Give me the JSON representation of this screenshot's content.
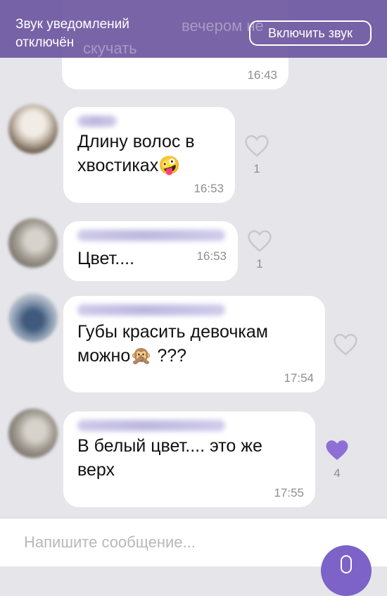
{
  "banner": {
    "text": "Звук уведомлений отключён",
    "button_label": "Включить звук",
    "ghost_text": "вечером не",
    "ghost_text_2": "скучать"
  },
  "messages": [
    {
      "time": "16:43"
    },
    {
      "text": "Длину волос в хвостиках",
      "emoji": "🤪",
      "time": "16:53",
      "likes": "1",
      "liked": false
    },
    {
      "text": "Цвет....",
      "time": "16:53",
      "likes": "1",
      "liked": false
    },
    {
      "text": "Губы красить девочкам можно",
      "emoji": "🙊",
      "suffix": " ???",
      "time": "17:54",
      "liked": false
    },
    {
      "text": "В белый цвет.... это же верх",
      "time": "17:55",
      "likes": "4",
      "liked": true
    }
  ],
  "composer": {
    "placeholder": "Напишите сообщение..."
  },
  "colors": {
    "accent": "#7d62c8",
    "banner": "#6e58a0",
    "background": "#e5e5ea",
    "like_active": "#8d6fd6",
    "like_inactive": "#c8c8cc"
  }
}
